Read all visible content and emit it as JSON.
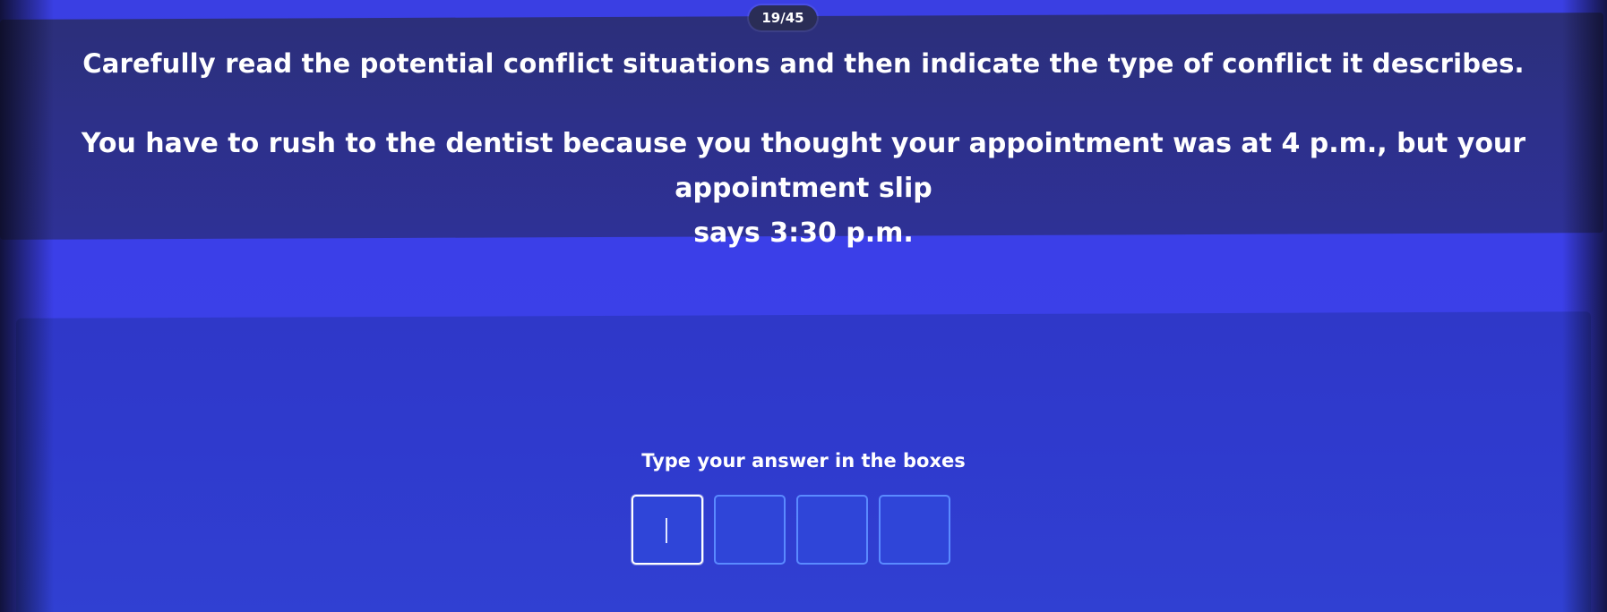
{
  "progress": {
    "counter": "19/45"
  },
  "question": {
    "instruction": "Carefully read the potential conflict situations and then indicate the type of conflict it describes.",
    "scenario_line1": "You have to rush to the dentist because you thought your appointment was at 4 p.m., but your appointment slip",
    "scenario_line2": "says 3:30 p.m."
  },
  "answer": {
    "hint": "Type your answer in the boxes",
    "boxes": [
      {
        "value": ""
      },
      {
        "value": ""
      },
      {
        "value": ""
      },
      {
        "value": ""
      }
    ]
  },
  "colors": {
    "background": "#3a3fe3",
    "question_panel": "#2d308a",
    "answer_panel": "#2f3acd",
    "box_border": "#5a8aff",
    "active_box_border": "#ffffff"
  }
}
